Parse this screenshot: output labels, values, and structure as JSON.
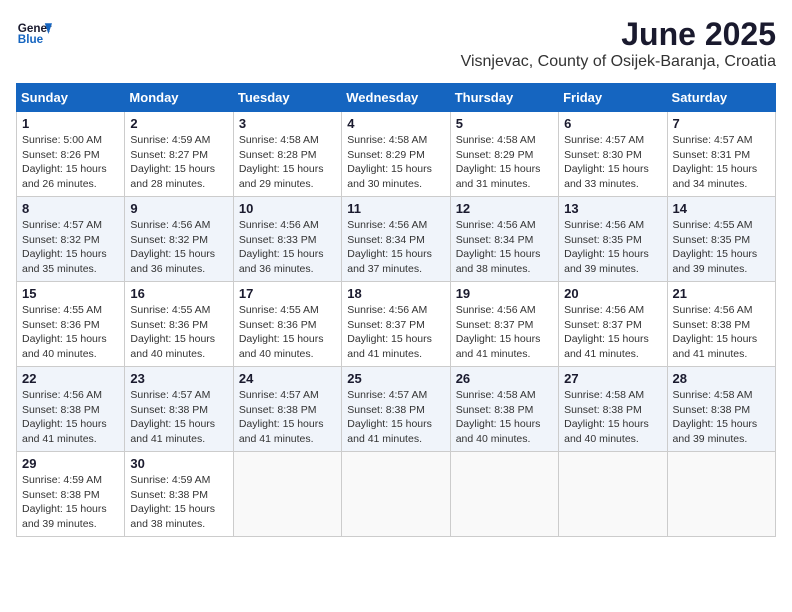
{
  "header": {
    "logo_line1": "General",
    "logo_line2": "Blue",
    "title": "June 2025",
    "subtitle": "Visnjevac, County of Osijek-Baranja, Croatia"
  },
  "calendar": {
    "weekdays": [
      "Sunday",
      "Monday",
      "Tuesday",
      "Wednesday",
      "Thursday",
      "Friday",
      "Saturday"
    ],
    "weeks": [
      [
        {
          "day": "1",
          "info": "Sunrise: 5:00 AM\nSunset: 8:26 PM\nDaylight: 15 hours\nand 26 minutes."
        },
        {
          "day": "2",
          "info": "Sunrise: 4:59 AM\nSunset: 8:27 PM\nDaylight: 15 hours\nand 28 minutes."
        },
        {
          "day": "3",
          "info": "Sunrise: 4:58 AM\nSunset: 8:28 PM\nDaylight: 15 hours\nand 29 minutes."
        },
        {
          "day": "4",
          "info": "Sunrise: 4:58 AM\nSunset: 8:29 PM\nDaylight: 15 hours\nand 30 minutes."
        },
        {
          "day": "5",
          "info": "Sunrise: 4:58 AM\nSunset: 8:29 PM\nDaylight: 15 hours\nand 31 minutes."
        },
        {
          "day": "6",
          "info": "Sunrise: 4:57 AM\nSunset: 8:30 PM\nDaylight: 15 hours\nand 33 minutes."
        },
        {
          "day": "7",
          "info": "Sunrise: 4:57 AM\nSunset: 8:31 PM\nDaylight: 15 hours\nand 34 minutes."
        }
      ],
      [
        {
          "day": "8",
          "info": "Sunrise: 4:57 AM\nSunset: 8:32 PM\nDaylight: 15 hours\nand 35 minutes."
        },
        {
          "day": "9",
          "info": "Sunrise: 4:56 AM\nSunset: 8:32 PM\nDaylight: 15 hours\nand 36 minutes."
        },
        {
          "day": "10",
          "info": "Sunrise: 4:56 AM\nSunset: 8:33 PM\nDaylight: 15 hours\nand 36 minutes."
        },
        {
          "day": "11",
          "info": "Sunrise: 4:56 AM\nSunset: 8:34 PM\nDaylight: 15 hours\nand 37 minutes."
        },
        {
          "day": "12",
          "info": "Sunrise: 4:56 AM\nSunset: 8:34 PM\nDaylight: 15 hours\nand 38 minutes."
        },
        {
          "day": "13",
          "info": "Sunrise: 4:56 AM\nSunset: 8:35 PM\nDaylight: 15 hours\nand 39 minutes."
        },
        {
          "day": "14",
          "info": "Sunrise: 4:55 AM\nSunset: 8:35 PM\nDaylight: 15 hours\nand 39 minutes."
        }
      ],
      [
        {
          "day": "15",
          "info": "Sunrise: 4:55 AM\nSunset: 8:36 PM\nDaylight: 15 hours\nand 40 minutes."
        },
        {
          "day": "16",
          "info": "Sunrise: 4:55 AM\nSunset: 8:36 PM\nDaylight: 15 hours\nand 40 minutes."
        },
        {
          "day": "17",
          "info": "Sunrise: 4:55 AM\nSunset: 8:36 PM\nDaylight: 15 hours\nand 40 minutes."
        },
        {
          "day": "18",
          "info": "Sunrise: 4:56 AM\nSunset: 8:37 PM\nDaylight: 15 hours\nand 41 minutes."
        },
        {
          "day": "19",
          "info": "Sunrise: 4:56 AM\nSunset: 8:37 PM\nDaylight: 15 hours\nand 41 minutes."
        },
        {
          "day": "20",
          "info": "Sunrise: 4:56 AM\nSunset: 8:37 PM\nDaylight: 15 hours\nand 41 minutes."
        },
        {
          "day": "21",
          "info": "Sunrise: 4:56 AM\nSunset: 8:38 PM\nDaylight: 15 hours\nand 41 minutes."
        }
      ],
      [
        {
          "day": "22",
          "info": "Sunrise: 4:56 AM\nSunset: 8:38 PM\nDaylight: 15 hours\nand 41 minutes."
        },
        {
          "day": "23",
          "info": "Sunrise: 4:57 AM\nSunset: 8:38 PM\nDaylight: 15 hours\nand 41 minutes."
        },
        {
          "day": "24",
          "info": "Sunrise: 4:57 AM\nSunset: 8:38 PM\nDaylight: 15 hours\nand 41 minutes."
        },
        {
          "day": "25",
          "info": "Sunrise: 4:57 AM\nSunset: 8:38 PM\nDaylight: 15 hours\nand 41 minutes."
        },
        {
          "day": "26",
          "info": "Sunrise: 4:58 AM\nSunset: 8:38 PM\nDaylight: 15 hours\nand 40 minutes."
        },
        {
          "day": "27",
          "info": "Sunrise: 4:58 AM\nSunset: 8:38 PM\nDaylight: 15 hours\nand 40 minutes."
        },
        {
          "day": "28",
          "info": "Sunrise: 4:58 AM\nSunset: 8:38 PM\nDaylight: 15 hours\nand 39 minutes."
        }
      ],
      [
        {
          "day": "29",
          "info": "Sunrise: 4:59 AM\nSunset: 8:38 PM\nDaylight: 15 hours\nand 39 minutes."
        },
        {
          "day": "30",
          "info": "Sunrise: 4:59 AM\nSunset: 8:38 PM\nDaylight: 15 hours\nand 38 minutes."
        },
        {
          "day": "",
          "info": ""
        },
        {
          "day": "",
          "info": ""
        },
        {
          "day": "",
          "info": ""
        },
        {
          "day": "",
          "info": ""
        },
        {
          "day": "",
          "info": ""
        }
      ]
    ]
  }
}
